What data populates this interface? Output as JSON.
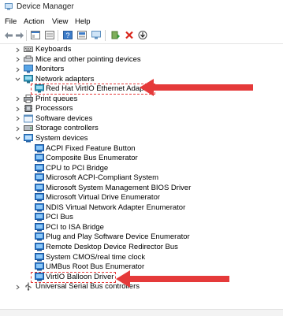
{
  "window": {
    "title": "Device Manager"
  },
  "menu": [
    "File",
    "Action",
    "View",
    "Help"
  ],
  "toolbar": {
    "icons": [
      "back-arrow-icon",
      "forward-arrow-icon",
      "tree-view-icon",
      "properties-icon",
      "help-icon",
      "show-hidden-icon",
      "monitor-icon",
      "update-driver-icon",
      "uninstall-icon",
      "scan-hardware-icon"
    ]
  },
  "tree": [
    {
      "label": "Keyboards",
      "expander": "collapsed",
      "icon": "keyboard-icon"
    },
    {
      "label": "Mice and other pointing devices",
      "expander": "collapsed",
      "icon": "mouse-icon"
    },
    {
      "label": "Monitors",
      "expander": "collapsed",
      "icon": "monitor-icon"
    },
    {
      "label": "Network adapters",
      "expander": "expanded",
      "icon": "network-icon"
    },
    {
      "label": "Red Hat VirtIO Ethernet Adapter",
      "expander": "none",
      "icon": "network-icon",
      "child": true,
      "highlight": true
    },
    {
      "label": "Print queues",
      "expander": "collapsed",
      "icon": "printer-icon"
    },
    {
      "label": "Processors",
      "expander": "collapsed",
      "icon": "processor-icon"
    },
    {
      "label": "Software devices",
      "expander": "collapsed",
      "icon": "software-icon"
    },
    {
      "label": "Storage controllers",
      "expander": "collapsed",
      "icon": "storage-icon"
    },
    {
      "label": "System devices",
      "expander": "expanded",
      "icon": "system-folder-icon"
    },
    {
      "label": "ACPI Fixed Feature Button",
      "expander": "none",
      "icon": "system-device-icon",
      "child": true
    },
    {
      "label": "Composite Bus Enumerator",
      "expander": "none",
      "icon": "system-device-icon",
      "child": true
    },
    {
      "label": "CPU to PCI Bridge",
      "expander": "none",
      "icon": "system-device-icon",
      "child": true
    },
    {
      "label": "Microsoft ACPI-Compliant System",
      "expander": "none",
      "icon": "system-device-icon",
      "child": true
    },
    {
      "label": "Microsoft System Management BIOS Driver",
      "expander": "none",
      "icon": "system-device-icon",
      "child": true
    },
    {
      "label": "Microsoft Virtual Drive Enumerator",
      "expander": "none",
      "icon": "system-device-icon",
      "child": true
    },
    {
      "label": "NDIS Virtual Network Adapter Enumerator",
      "expander": "none",
      "icon": "system-device-icon",
      "child": true
    },
    {
      "label": "PCI Bus",
      "expander": "none",
      "icon": "system-device-icon",
      "child": true
    },
    {
      "label": "PCI to ISA Bridge",
      "expander": "none",
      "icon": "system-device-icon",
      "child": true
    },
    {
      "label": "Plug and Play Software Device Enumerator",
      "expander": "none",
      "icon": "system-device-icon",
      "child": true
    },
    {
      "label": "Remote Desktop Device Redirector Bus",
      "expander": "none",
      "icon": "system-device-icon",
      "child": true
    },
    {
      "label": "System CMOS/real time clock",
      "expander": "none",
      "icon": "system-device-icon",
      "child": true
    },
    {
      "label": "UMBus Root Bus Enumerator",
      "expander": "none",
      "icon": "system-device-icon",
      "child": true
    },
    {
      "label": "VirtIO Balloon Driver",
      "expander": "none",
      "icon": "system-device-icon",
      "child": true,
      "highlight": true
    },
    {
      "label": "Universal Serial Bus controllers",
      "expander": "collapsed",
      "icon": "usb-icon"
    }
  ],
  "colors": {
    "annotation": "#e53a3a",
    "icon_blue": "#2f7fd3",
    "icon_teal": "#3aa3c7"
  }
}
